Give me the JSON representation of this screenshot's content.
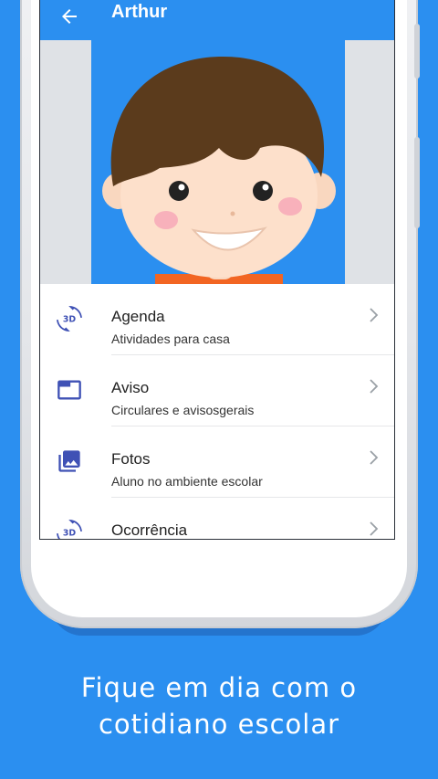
{
  "app_bar": {
    "title": "Arthur",
    "background_color": "#2b8ff0",
    "back_icon": "arrow-left-icon"
  },
  "profile": {
    "avatar": "boy-avatar-illustration"
  },
  "menu": {
    "items": [
      {
        "title": "Agenda",
        "subtitle": "Atividades para casa",
        "icon": "rotate-3d-icon"
      },
      {
        "title": "Aviso",
        "subtitle": "Circulares e avisosgerais",
        "icon": "window-icon"
      },
      {
        "title": "Fotos",
        "subtitle": "Aluno no ambiente escolar",
        "icon": "photo-library-icon"
      },
      {
        "title": "Ocorrência",
        "subtitle": "",
        "icon": "rotate-3d-icon"
      }
    ],
    "chevron_icon": "chevron-right-icon",
    "icon_color": "#3f51b5"
  },
  "promo": {
    "line1": "Fique em dia com o",
    "line2": "cotidiano escolar",
    "background_color": "#2b8ff0"
  }
}
